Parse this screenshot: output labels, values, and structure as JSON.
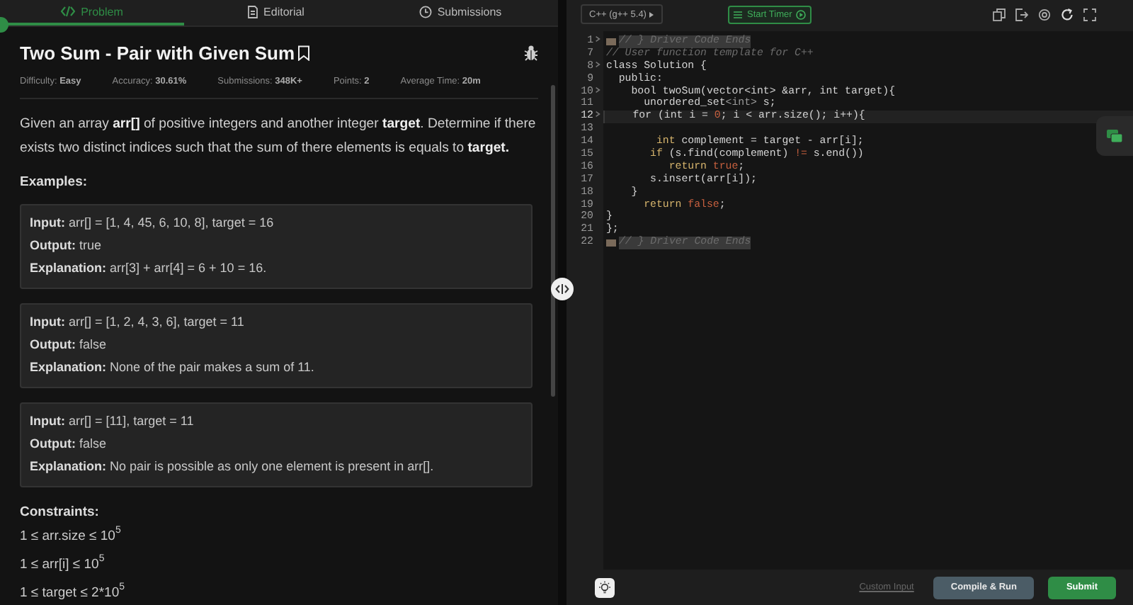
{
  "problem_tabs": [
    {
      "label": "Problem",
      "selected": true
    },
    {
      "label": "Editorial",
      "selected": false
    },
    {
      "label": "Submissions",
      "selected": false
    }
  ],
  "problem": {
    "title": "Two Sum - Pair with Given Sum",
    "meta": [
      "Difficulty: **Easy**",
      "Accuracy: **30.61%**",
      "Submissions: **348K+**",
      "Points: **2**",
      "Average Time: **20m**"
    ],
    "description": "Given an array **arr[]** of positive integers and another integer **target**. Determine if there exists two distinct indices such that the sum of there elements is equals to **target.**",
    "examples_heading": "Examples:",
    "examples": [
      {
        "input": "**Input:** arr[] = [1, 4, 45, 6, 10, 8], target = 16",
        "output": "**Output:** true",
        "explanation": "**Explanation:** arr[3] + arr[4] = 6 + 10 = 16."
      },
      {
        "input": "**Input:** arr[] = [1, 2, 4, 3, 6], target = 11",
        "output": "**Output:** false",
        "explanation": "**Explanation:** None of the pair makes a sum of 11."
      },
      {
        "input": "**Input:** arr[] = [11], target = 11",
        "output": "**Output:** false",
        "explanation": "**Explanation:** No pair is possible as only one element is present in arr[]."
      }
    ],
    "constraints_heading": "Constraints:",
    "constraints": [
      "1 ≤ arr.size ≤ 10$^{5}$",
      "1 ≤ arr[i] ≤ 10$^{5}$",
      "1 ≤ target ≤ 2*10$^{5}$"
    ]
  },
  "editor": {
    "language": "C++ (g++ 5.4)",
    "timer": "Start Timer",
    "lines": [
      {
        "number": "1",
        "foldable": true,
        "folded": true,
        "current": false,
        "tokens": [
          {
            "text": "// } Driver Code Ends",
            "kind": "comment"
          }
        ]
      },
      {
        "number": "7",
        "foldable": false,
        "folded": false,
        "current": false,
        "tokens": [
          {
            "text": "// User function template for C++",
            "kind": "comment"
          }
        ]
      },
      {
        "number": "8",
        "foldable": true,
        "folded": false,
        "current": false,
        "tokens": [
          {
            "text": "class Solution {",
            "kind": "plain"
          }
        ]
      },
      {
        "number": "9",
        "foldable": false,
        "folded": false,
        "current": false,
        "tokens": [
          {
            "text": "  public:",
            "kind": "plain"
          }
        ]
      },
      {
        "number": "10",
        "foldable": true,
        "folded": false,
        "current": false,
        "tokens": [
          {
            "text": "    bool twoSum(vector<int> &arr, int target){",
            "kind": "plain"
          }
        ]
      },
      {
        "number": "11",
        "foldable": false,
        "folded": false,
        "current": false,
        "tokens": [
          {
            "text": "      unordered_set",
            "kind": "plain"
          },
          {
            "text": "<int>",
            "kind": "type"
          },
          {
            "text": " s;",
            "kind": "plain"
          }
        ]
      },
      {
        "number": "12",
        "foldable": true,
        "folded": false,
        "current": true,
        "tokens": [
          {
            "text": "    for (int i = ",
            "kind": "plain"
          },
          {
            "text": "0",
            "kind": "literal"
          },
          {
            "text": "; i < arr.size(); i++){",
            "kind": "plain"
          }
        ]
      },
      {
        "number": "13",
        "foldable": false,
        "folded": false,
        "current": false
      },
      {
        "number": "14",
        "foldable": false,
        "folded": false,
        "current": false,
        "tokens": [
          {
            "text": "        int",
            "kind": "keyword"
          },
          {
            "text": " complement = target - arr[i];",
            "kind": "plain"
          }
        ]
      },
      {
        "number": "15",
        "foldable": false,
        "folded": false,
        "current": false,
        "tokens": [
          {
            "text": "       if",
            "kind": "keyword"
          },
          {
            "text": " (s.find(complement) ",
            "kind": "plain"
          },
          {
            "text": "!=",
            "kind": "literal"
          },
          {
            "text": " s.end())",
            "kind": "plain"
          }
        ]
      },
      {
        "number": "16",
        "foldable": false,
        "folded": false,
        "current": false,
        "tokens": [
          {
            "text": "          return",
            "kind": "keyword"
          },
          {
            "text": " true",
            "kind": "literal"
          },
          {
            "text": ";",
            "kind": "plain"
          }
        ]
      },
      {
        "number": "17",
        "foldable": false,
        "folded": false,
        "current": false,
        "tokens": [
          {
            "text": "       s.insert(arr[i]);",
            "kind": "plain"
          }
        ]
      },
      {
        "number": "18",
        "foldable": false,
        "folded": false,
        "current": false,
        "tokens": [
          {
            "text": "    }",
            "kind": "plain"
          }
        ]
      },
      {
        "number": "19",
        "foldable": false,
        "folded": false,
        "current": false,
        "tokens": [
          {
            "text": "      return",
            "kind": "keyword"
          },
          {
            "text": " false",
            "kind": "literal"
          },
          {
            "text": ";",
            "kind": "plain"
          }
        ]
      },
      {
        "number": "20",
        "foldable": false,
        "folded": false,
        "current": false,
        "tokens": [
          {
            "text": "}",
            "kind": "plain"
          }
        ]
      },
      {
        "number": "21",
        "foldable": false,
        "folded": false,
        "current": false,
        "tokens": [
          {
            "text": "};",
            "kind": "plain"
          }
        ]
      },
      {
        "number": "22",
        "foldable": false,
        "folded": true,
        "current": false,
        "tokens": [
          {
            "text": "// } Driver Code Ends",
            "kind": "comment"
          }
        ]
      }
    ],
    "custom_input": "Custom Input",
    "compile_button": "Compile & Run",
    "submit_button": "Submit"
  }
}
